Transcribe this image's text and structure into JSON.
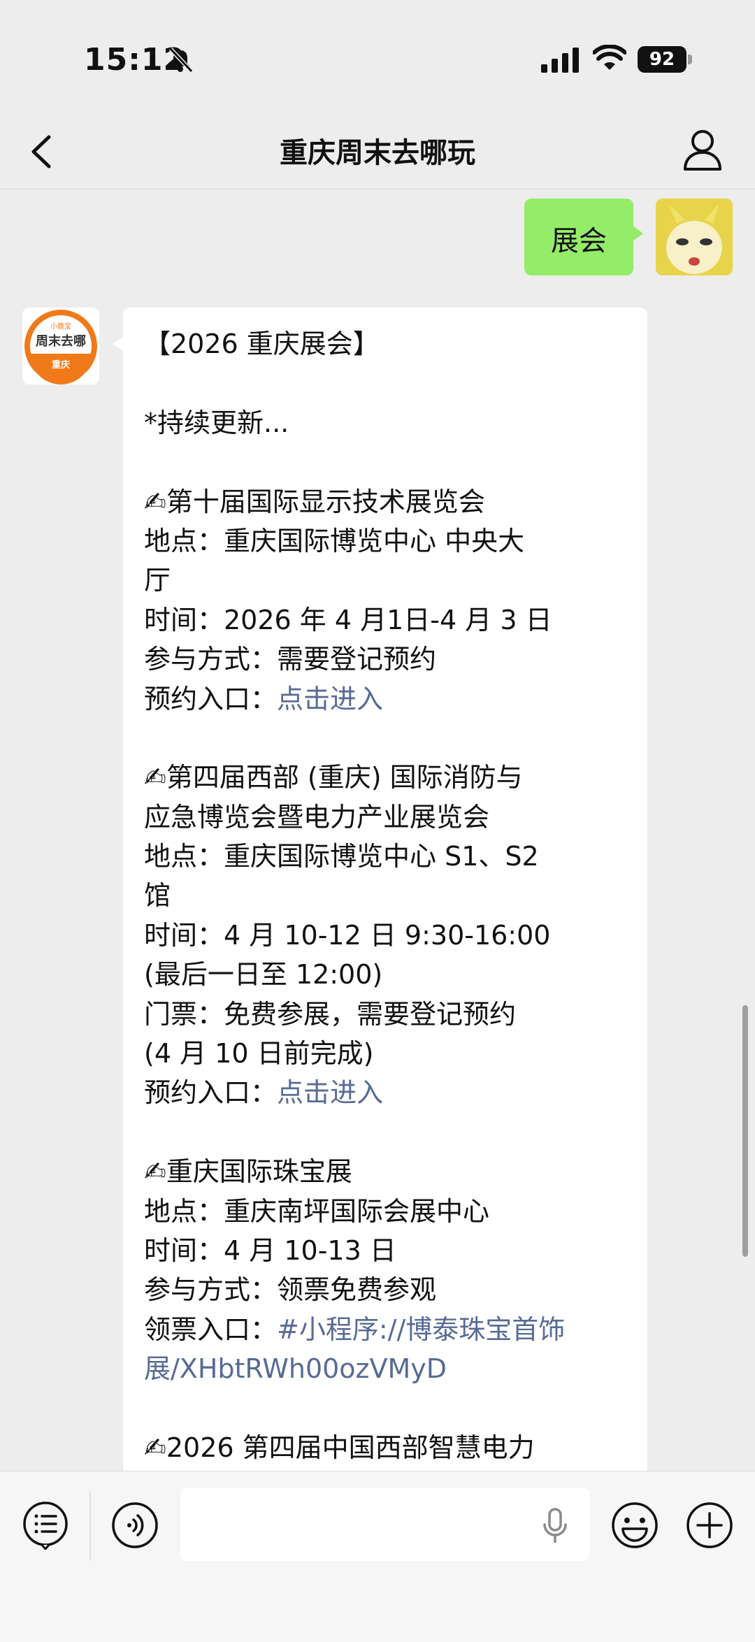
{
  "status": {
    "time": "15:12",
    "battery": "92"
  },
  "nav": {
    "title": "重庆周末去哪玩"
  },
  "sent_message": {
    "text": "展会"
  },
  "bot": {
    "avatar_top": "小鹿宝",
    "avatar_middle": "周末去哪",
    "avatar_bottom": "重庆"
  },
  "message_lines": [
    {
      "text": "【2026 重庆展会】"
    },
    {
      "text": ""
    },
    {
      "text": "*持续更新..."
    },
    {
      "text": ""
    },
    {
      "text": "✍第十届国际显示技术展览会"
    },
    {
      "text": "地点：重庆国际博览中心 中央大"
    },
    {
      "text": "厅"
    },
    {
      "text": "时间：2026 年 4 月1日-4 月 3 日"
    },
    {
      "text": "参与方式：需要登记预约"
    },
    {
      "label": "预约入口：",
      "link": "点击进入"
    },
    {
      "text": ""
    },
    {
      "text": "✍第四届西部 (重庆) 国际消防与"
    },
    {
      "text": "应急博览会暨电力产业展览会"
    },
    {
      "text": "地点：重庆国际博览中心 S1、S2"
    },
    {
      "text": "馆"
    },
    {
      "text": "时间：4 月 10-12 日 9:30-16:00"
    },
    {
      "text": "(最后一日至 12:00)"
    },
    {
      "text": "门票：免费参展，需要登记预约"
    },
    {
      "text": "(4 月 10 日前完成)"
    },
    {
      "label": "预约入口：",
      "link": "点击进入"
    },
    {
      "text": ""
    },
    {
      "text": "✍重庆国际珠宝展"
    },
    {
      "text": "地点：重庆南坪国际会展中心"
    },
    {
      "text": "时间：4 月 10-13 日"
    },
    {
      "text": "参与方式：领票免费参观"
    },
    {
      "label": "领票入口：",
      "link": "#小程序://博泰珠宝首饰"
    },
    {
      "link": "展/XHbtRWh00ozVMyD"
    },
    {
      "text": ""
    },
    {
      "text": "✍2026 第四届中国西部智慧电力"
    }
  ]
}
